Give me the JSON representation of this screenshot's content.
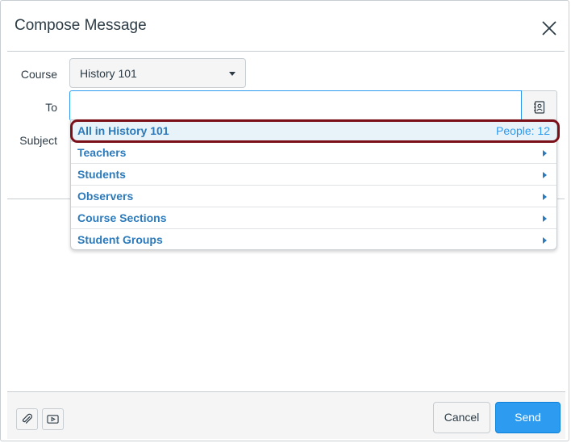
{
  "dialog": {
    "title": "Compose Message",
    "close_icon": "close-icon"
  },
  "form": {
    "course_label": "Course",
    "course_value": "History 101",
    "to_label": "To",
    "to_value": "",
    "subject_label": "Subject",
    "address_book_icon": "address-book-icon"
  },
  "dropdown": {
    "items": [
      {
        "label": "All in History 101",
        "count": "People: 12",
        "highlighted": true
      },
      {
        "label": "Teachers"
      },
      {
        "label": "Students"
      },
      {
        "label": "Observers"
      },
      {
        "label": "Course Sections"
      },
      {
        "label": "Student Groups"
      }
    ]
  },
  "footer": {
    "attach_icon": "paperclip-icon",
    "media_icon": "media-icon",
    "cancel_label": "Cancel",
    "send_label": "Send"
  },
  "colors": {
    "accent": "#2d9bf0",
    "link": "#2b7abc",
    "highlight_ring": "#7b1019"
  }
}
